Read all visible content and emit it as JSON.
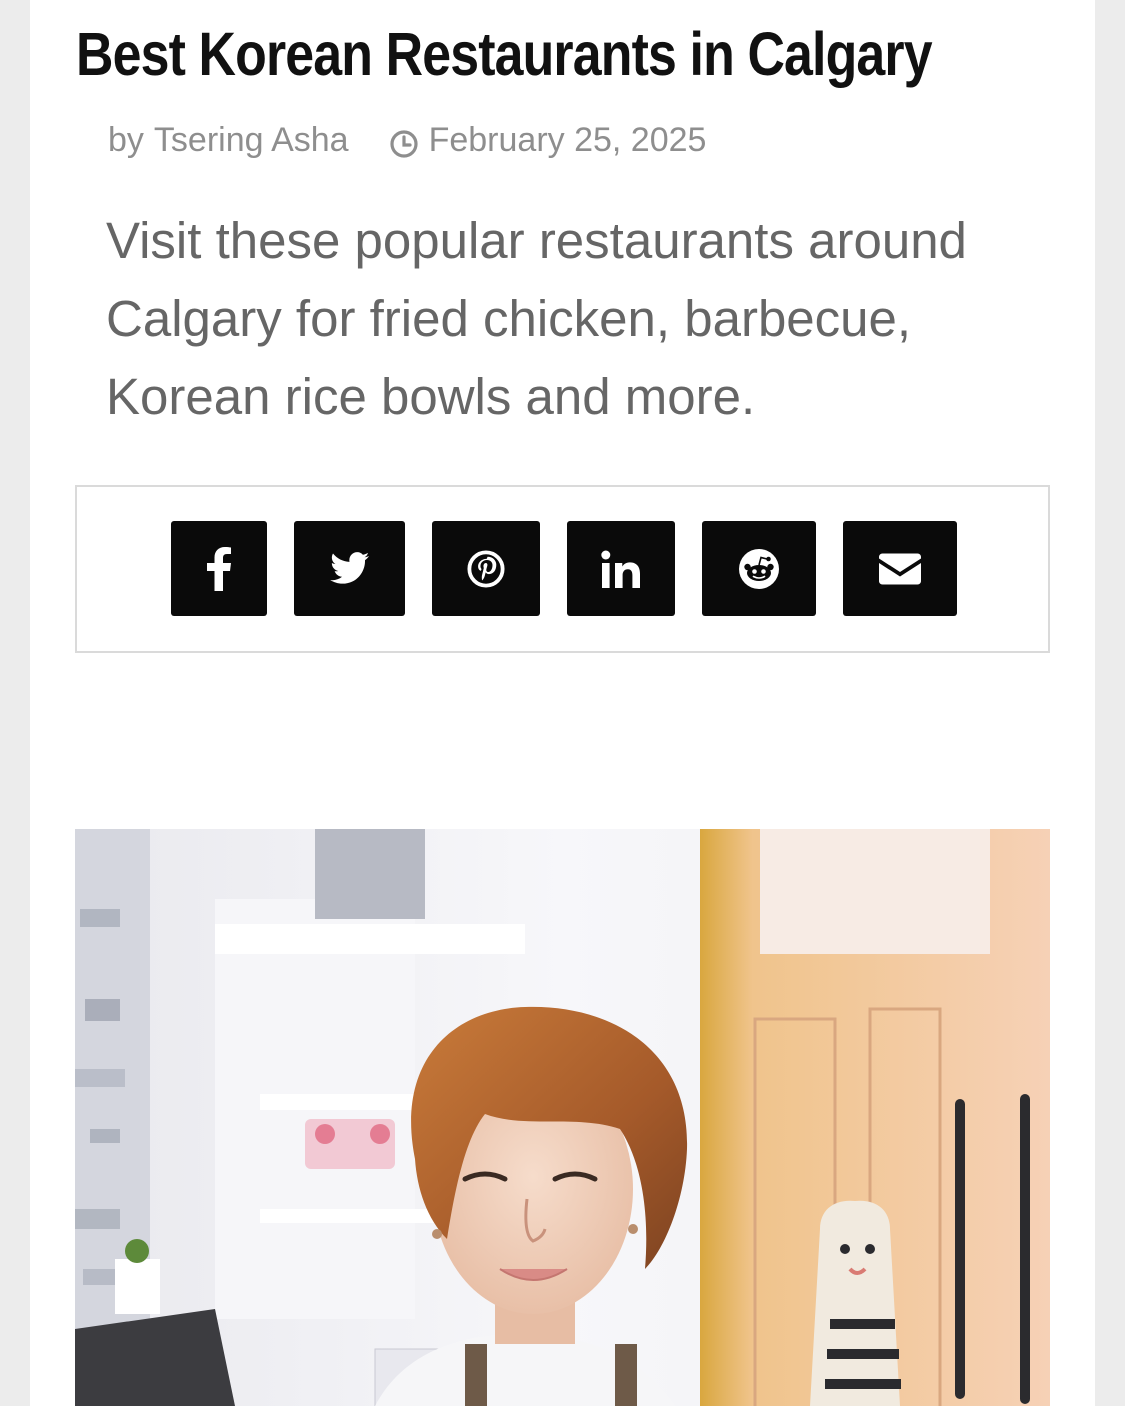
{
  "article": {
    "title": "Best Korean Restaurants in Calgary",
    "byline_prefix": "by",
    "author": "Tsering Asha",
    "date": "February 25, 2025",
    "excerpt": "Visit these popular restaurants around Calgary for fried chicken, barbecue, Korean rice bowls and more."
  },
  "share": {
    "buttons": [
      {
        "network": "facebook",
        "icon": "facebook-icon"
      },
      {
        "network": "twitter",
        "icon": "twitter-icon"
      },
      {
        "network": "pinterest",
        "icon": "pinterest-icon"
      },
      {
        "network": "linkedin",
        "icon": "linkedin-icon"
      },
      {
        "network": "reddit",
        "icon": "reddit-icon"
      },
      {
        "network": "email",
        "icon": "envelope-icon"
      }
    ],
    "button_color": "#0a0a0a"
  },
  "featured_image": {
    "subject": "portrait of a smiling woman with short auburn hair in a bright cafe"
  },
  "colors": {
    "title": "#111111",
    "meta": "#8e8e8e",
    "excerpt": "#666666",
    "page_background": "#ececec"
  }
}
